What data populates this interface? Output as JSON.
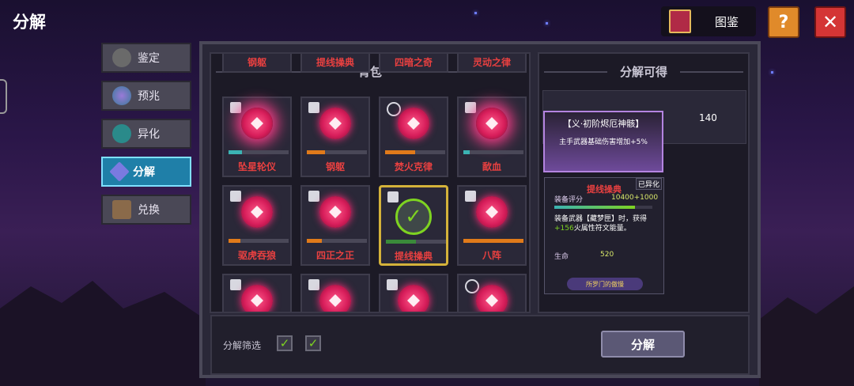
{
  "header": {
    "title": "分解",
    "codex_label": "图鉴",
    "help_label": "?",
    "close_label": "✕"
  },
  "sidebar": {
    "tabs": [
      {
        "label": "鉴定",
        "icon": "helmet-icon"
      },
      {
        "label": "预兆",
        "icon": "crystal-ball-icon"
      },
      {
        "label": "异化",
        "icon": "demon-mask-icon"
      },
      {
        "label": "分解",
        "icon": "gem-icon",
        "active": true
      },
      {
        "label": "兑换",
        "icon": "chest-icon"
      }
    ]
  },
  "bag": {
    "title": "背包",
    "partial_top_row": [
      "钢躯",
      "提线操典",
      "四暗之奇",
      "灵动之律"
    ],
    "items": [
      {
        "name": "坠星轮仪",
        "bar_color": "#3bb3b3",
        "bar_fill": 0.22,
        "glow": true,
        "selected": false,
        "slot": "armor"
      },
      {
        "name": "钢躯",
        "bar_color": "#e07a1a",
        "bar_fill": 0.3,
        "glow": false,
        "selected": false,
        "slot": "shirt"
      },
      {
        "name": "焚火克律",
        "bar_color": "#e07a1a",
        "bar_fill": 0.5,
        "glow": false,
        "selected": false,
        "slot": "ring"
      },
      {
        "name": "歃血",
        "bar_color": "#3bb3b3",
        "bar_fill": 0.1,
        "glow": true,
        "selected": false,
        "slot": "shirt"
      },
      {
        "name": "驱虎吞狼",
        "bar_color": "#e07a1a",
        "bar_fill": 0.2,
        "glow": false,
        "selected": false,
        "slot": "shirt"
      },
      {
        "name": "四正之正",
        "bar_color": "#e07a1a",
        "bar_fill": 0.25,
        "glow": false,
        "selected": false,
        "slot": "shirt"
      },
      {
        "name": "提线操典",
        "bar_color": "#3a8a3a",
        "bar_fill": 0.5,
        "glow": false,
        "selected": true,
        "slot": "armor"
      },
      {
        "name": "八阵",
        "bar_color": "#e07a1a",
        "bar_fill": 1.0,
        "glow": false,
        "selected": false,
        "slot": "armor"
      },
      {
        "name": "",
        "bar_color": "#e07a1a",
        "bar_fill": 0,
        "glow": false,
        "selected": false,
        "slot": "armor"
      },
      {
        "name": "",
        "bar_color": "#e07a1a",
        "bar_fill": 0,
        "glow": false,
        "selected": false,
        "slot": "shirt"
      },
      {
        "name": "",
        "bar_color": "#e07a1a",
        "bar_fill": 0,
        "glow": false,
        "selected": false,
        "slot": "armor"
      },
      {
        "name": "",
        "bar_color": "#e07a1a",
        "bar_fill": 0,
        "glow": false,
        "selected": false,
        "slot": "ring"
      }
    ]
  },
  "result": {
    "title": "分解可得",
    "count": "140",
    "tooltip_title": "【义·初阶烬厄神骸】",
    "tooltip_text": "主手武器基础伤害增加+5%"
  },
  "card": {
    "name": "提线操典",
    "badge": "已异化",
    "score_label": "装备评分",
    "score_value": "10400+1000",
    "score_fill": 0.82,
    "desc_1": "装备武器【藏梦匣】时，获得",
    "desc_highlight": "+156",
    "desc_2": "火属性符文能量。",
    "stat_label": "生命",
    "stat_value": "520",
    "footer": "所罗门的傲慢"
  },
  "bottom": {
    "filter_label": "分解筛选",
    "checkbox_1": "✓",
    "checkbox_2": "✓",
    "decompose_label": "分解"
  },
  "colors": {
    "accent_active_tab": "#1f7fa8",
    "gem_red": "#d81e5b",
    "item_name_red": "#e84040",
    "check_green": "#7ed321",
    "selected_border": "#d4b23a"
  }
}
